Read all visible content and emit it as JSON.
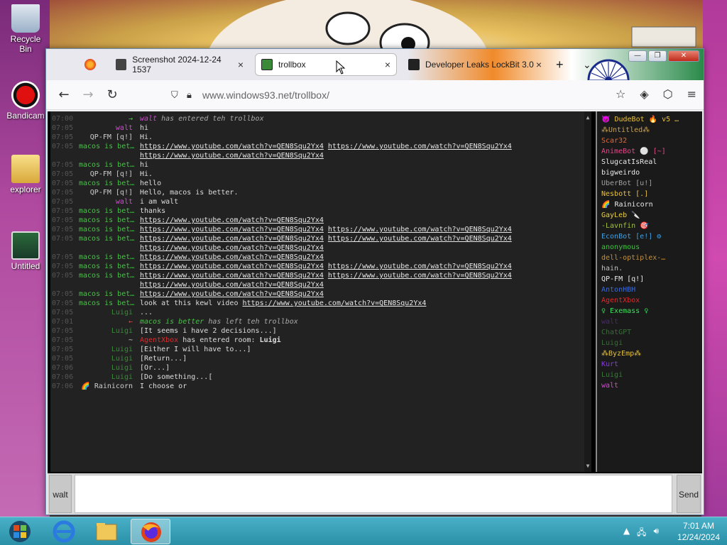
{
  "desktop": {
    "icons": [
      {
        "label": "Recycle Bin"
      },
      {
        "label": "Bandicam"
      },
      {
        "label": "explorer"
      },
      {
        "label": "Untitled"
      }
    ]
  },
  "browser": {
    "tabs": [
      {
        "label": "",
        "fav": "firefox-icon"
      },
      {
        "label": "Screenshot 2024-12-24 1537",
        "close": "×"
      },
      {
        "label": "trollbox",
        "close": "×"
      },
      {
        "label": "Developer Leaks LockBit 3.0",
        "close": "×"
      }
    ],
    "new_tab": "+",
    "tab_list": "⌄",
    "window": {
      "minimize": "—",
      "maximize": "❐",
      "close": "✕"
    },
    "nav": {
      "back": "←",
      "forward": "→",
      "reload": "↻"
    },
    "url": "www.windows93.net/trollbox/",
    "right_icons": [
      "☆",
      "◈",
      "⬡",
      "≡"
    ]
  },
  "chat": {
    "messages": [
      {
        "time": "07:00",
        "nick": "→",
        "nick_color": "#4ad04a",
        "text": "walt has entered teh trollbox",
        "type": "join",
        "nick2": "walt",
        "nick2_color": "#d04ad0"
      },
      {
        "time": "07:05",
        "nick": "walt",
        "nick_color": "#d04ad0",
        "text": "hi"
      },
      {
        "time": "07:05",
        "nick": "QP-FM [q!]",
        "nick_color": "#cccccc",
        "text": "Hi."
      },
      {
        "time": "07:05",
        "nick": "macos is bet…",
        "nick_color": "#4ac04a",
        "links": [
          "https://www.youtube.com/watch?v=QEN8Squ2Yx4",
          "https://www.youtube.com/watch?v=QEN8Squ2Yx4"
        ]
      },
      {
        "time": "",
        "nick": "",
        "nick_color": "#4ac04a",
        "links": [
          "https://www.youtube.com/watch?v=QEN8Squ2Yx4"
        ]
      },
      {
        "time": "07:05",
        "nick": "macos is bet…",
        "nick_color": "#4ac04a",
        "text": "hi"
      },
      {
        "time": "07:05",
        "nick": "QP-FM [q!]",
        "nick_color": "#cccccc",
        "text": "Hi."
      },
      {
        "time": "07:05",
        "nick": "macos is bet…",
        "nick_color": "#4ac04a",
        "text": "hello"
      },
      {
        "time": "07:05",
        "nick": "QP-FM [q!]",
        "nick_color": "#cccccc",
        "text": "Hello, macos is better."
      },
      {
        "time": "07:05",
        "nick": "walt",
        "nick_color": "#d04ad0",
        "text": "i am walt"
      },
      {
        "time": "07:05",
        "nick": "macos is bet…",
        "nick_color": "#4ac04a",
        "text": "thanks"
      },
      {
        "time": "07:05",
        "nick": "macos is bet…",
        "nick_color": "#4ac04a",
        "links": [
          "https://www.youtube.com/watch?v=QEN8Squ2Yx4"
        ]
      },
      {
        "time": "07:05",
        "nick": "macos is bet…",
        "nick_color": "#4ac04a",
        "links": [
          "https://www.youtube.com/watch?v=QEN8Squ2Yx4",
          "https://www.youtube.com/watch?v=QEN8Squ2Yx4"
        ]
      },
      {
        "time": "07:05",
        "nick": "macos is bet…",
        "nick_color": "#4ac04a",
        "links": [
          "https://www.youtube.com/watch?v=QEN8Squ2Yx4",
          "https://www.youtube.com/watch?v=QEN8Squ2Yx4"
        ]
      },
      {
        "time": "",
        "nick": "",
        "nick_color": "#4ac04a",
        "links": [
          "https://www.youtube.com/watch?v=QEN8Squ2Yx4"
        ]
      },
      {
        "time": "07:05",
        "nick": "macos is bet…",
        "nick_color": "#4ac04a",
        "links": [
          "https://www.youtube.com/watch?v=QEN8Squ2Yx4"
        ]
      },
      {
        "time": "07:05",
        "nick": "macos is bet…",
        "nick_color": "#4ac04a",
        "links": [
          "https://www.youtube.com/watch?v=QEN8Squ2Yx4",
          "https://www.youtube.com/watch?v=QEN8Squ2Yx4"
        ]
      },
      {
        "time": "07:05",
        "nick": "macos is bet…",
        "nick_color": "#4ac04a",
        "links": [
          "https://www.youtube.com/watch?v=QEN8Squ2Yx4",
          "https://www.youtube.com/watch?v=QEN8Squ2Yx4"
        ]
      },
      {
        "time": "",
        "nick": "",
        "nick_color": "#4ac04a",
        "links": [
          "https://www.youtube.com/watch?v=QEN8Squ2Yx4"
        ]
      },
      {
        "time": "07:05",
        "nick": "macos is bet…",
        "nick_color": "#4ac04a",
        "links": [
          "https://www.youtube.com/watch?v=QEN8Squ2Yx4"
        ]
      },
      {
        "time": "07:05",
        "nick": "macos is bet…",
        "nick_color": "#4ac04a",
        "text": "look at this kewl video ",
        "links": [
          "https://www.youtube.com/watch?v=QEN8Squ2Yx4"
        ]
      },
      {
        "time": "07:05",
        "nick": "Luigi",
        "nick_color": "#3a8a3a",
        "text": "..."
      },
      {
        "time": "07:01",
        "nick": "←",
        "nick_color": "#d04a4a",
        "text": "macos is better has left teh trollbox",
        "type": "leave",
        "nick2": "macos is better",
        "nick2_color": "#4ac04a"
      },
      {
        "time": "07:05",
        "nick": "Luigi",
        "nick_color": "#3a8a3a",
        "text": "[It seems i have 2 decisions...]"
      },
      {
        "time": "07:05",
        "nick": "~",
        "nick_color": "#cccccc",
        "text": "has entered room: ",
        "type": "room",
        "nick2": "AgentXbox",
        "nick2_color": "#e02a2a",
        "room": "Luigi"
      },
      {
        "time": "07:05",
        "nick": "Luigi",
        "nick_color": "#3a8a3a",
        "text": "[Either I will have to...]"
      },
      {
        "time": "07:05",
        "nick": "Luigi",
        "nick_color": "#3a8a3a",
        "text": "[Return...]"
      },
      {
        "time": "07:06",
        "nick": "Luigi",
        "nick_color": "#3a8a3a",
        "text": "[Or...]"
      },
      {
        "time": "07:06",
        "nick": "Luigi",
        "nick_color": "#3a8a3a",
        "text": "[Do something...["
      },
      {
        "time": "07:06",
        "nick": "🌈 Rainicorn",
        "nick_color": "#cccccc",
        "text": "I choose or"
      }
    ]
  },
  "users": [
    {
      "name": "😈 DudeBot 🔥 v5 …",
      "color": "#e8c040"
    },
    {
      "name": "⁂Untitled⁂",
      "color": "#c8a050"
    },
    {
      "name": "Scar32",
      "color": "#e06a3a"
    },
    {
      "name": "AnimeBot ⚪ [~]",
      "color": "#e04a8a"
    },
    {
      "name": "SlugcatIsReal",
      "color": "#e8e8e8"
    },
    {
      "name": "bigweirdo",
      "color": "#e8e8e8"
    },
    {
      "name": "UberBot [u!]",
      "color": "#a0a0a0"
    },
    {
      "name": "Nesbott [.]",
      "color": "#e8c040"
    },
    {
      "name": "🌈 Rainicorn",
      "color": "#e8e8e8"
    },
    {
      "name": "GayLeb 🔪",
      "color": "#e8d040"
    },
    {
      "name": "-Lavnfin 🎯",
      "color": "#a0c040"
    },
    {
      "name": "EconBot [e!] ⚙",
      "color": "#40a0e0"
    },
    {
      "name": "anonymous",
      "color": "#40c040"
    },
    {
      "name": "dell-optiplex-…",
      "color": "#c09040"
    },
    {
      "name": "hain.",
      "color": "#c0c0c0"
    },
    {
      "name": "QP-FM [q!]",
      "color": "#e8e8e8"
    },
    {
      "name": "AntonHBH",
      "color": "#3a6ae0"
    },
    {
      "name": "AgentXbox",
      "color": "#e02a2a"
    },
    {
      "name": "♀ Exemass ♀",
      "color": "#40e060"
    },
    {
      "name": "walt",
      "color": "#4a2a6a"
    },
    {
      "name": "ChatGPT",
      "color": "#3a6a3a"
    },
    {
      "name": "Luigi",
      "color": "#3a6a3a"
    },
    {
      "name": "⁂ByzEmp⁂",
      "color": "#e0c040"
    },
    {
      "name": "Kurt",
      "color": "#8a3ae0"
    },
    {
      "name": "Luigi",
      "color": "#3a7a3a"
    },
    {
      "name": "walt",
      "color": "#d04ad0"
    }
  ],
  "input": {
    "nick": "walt",
    "send": "Send",
    "value": ""
  },
  "taskbar": {
    "time": "7:01 AM",
    "date": "12/24/2024"
  }
}
